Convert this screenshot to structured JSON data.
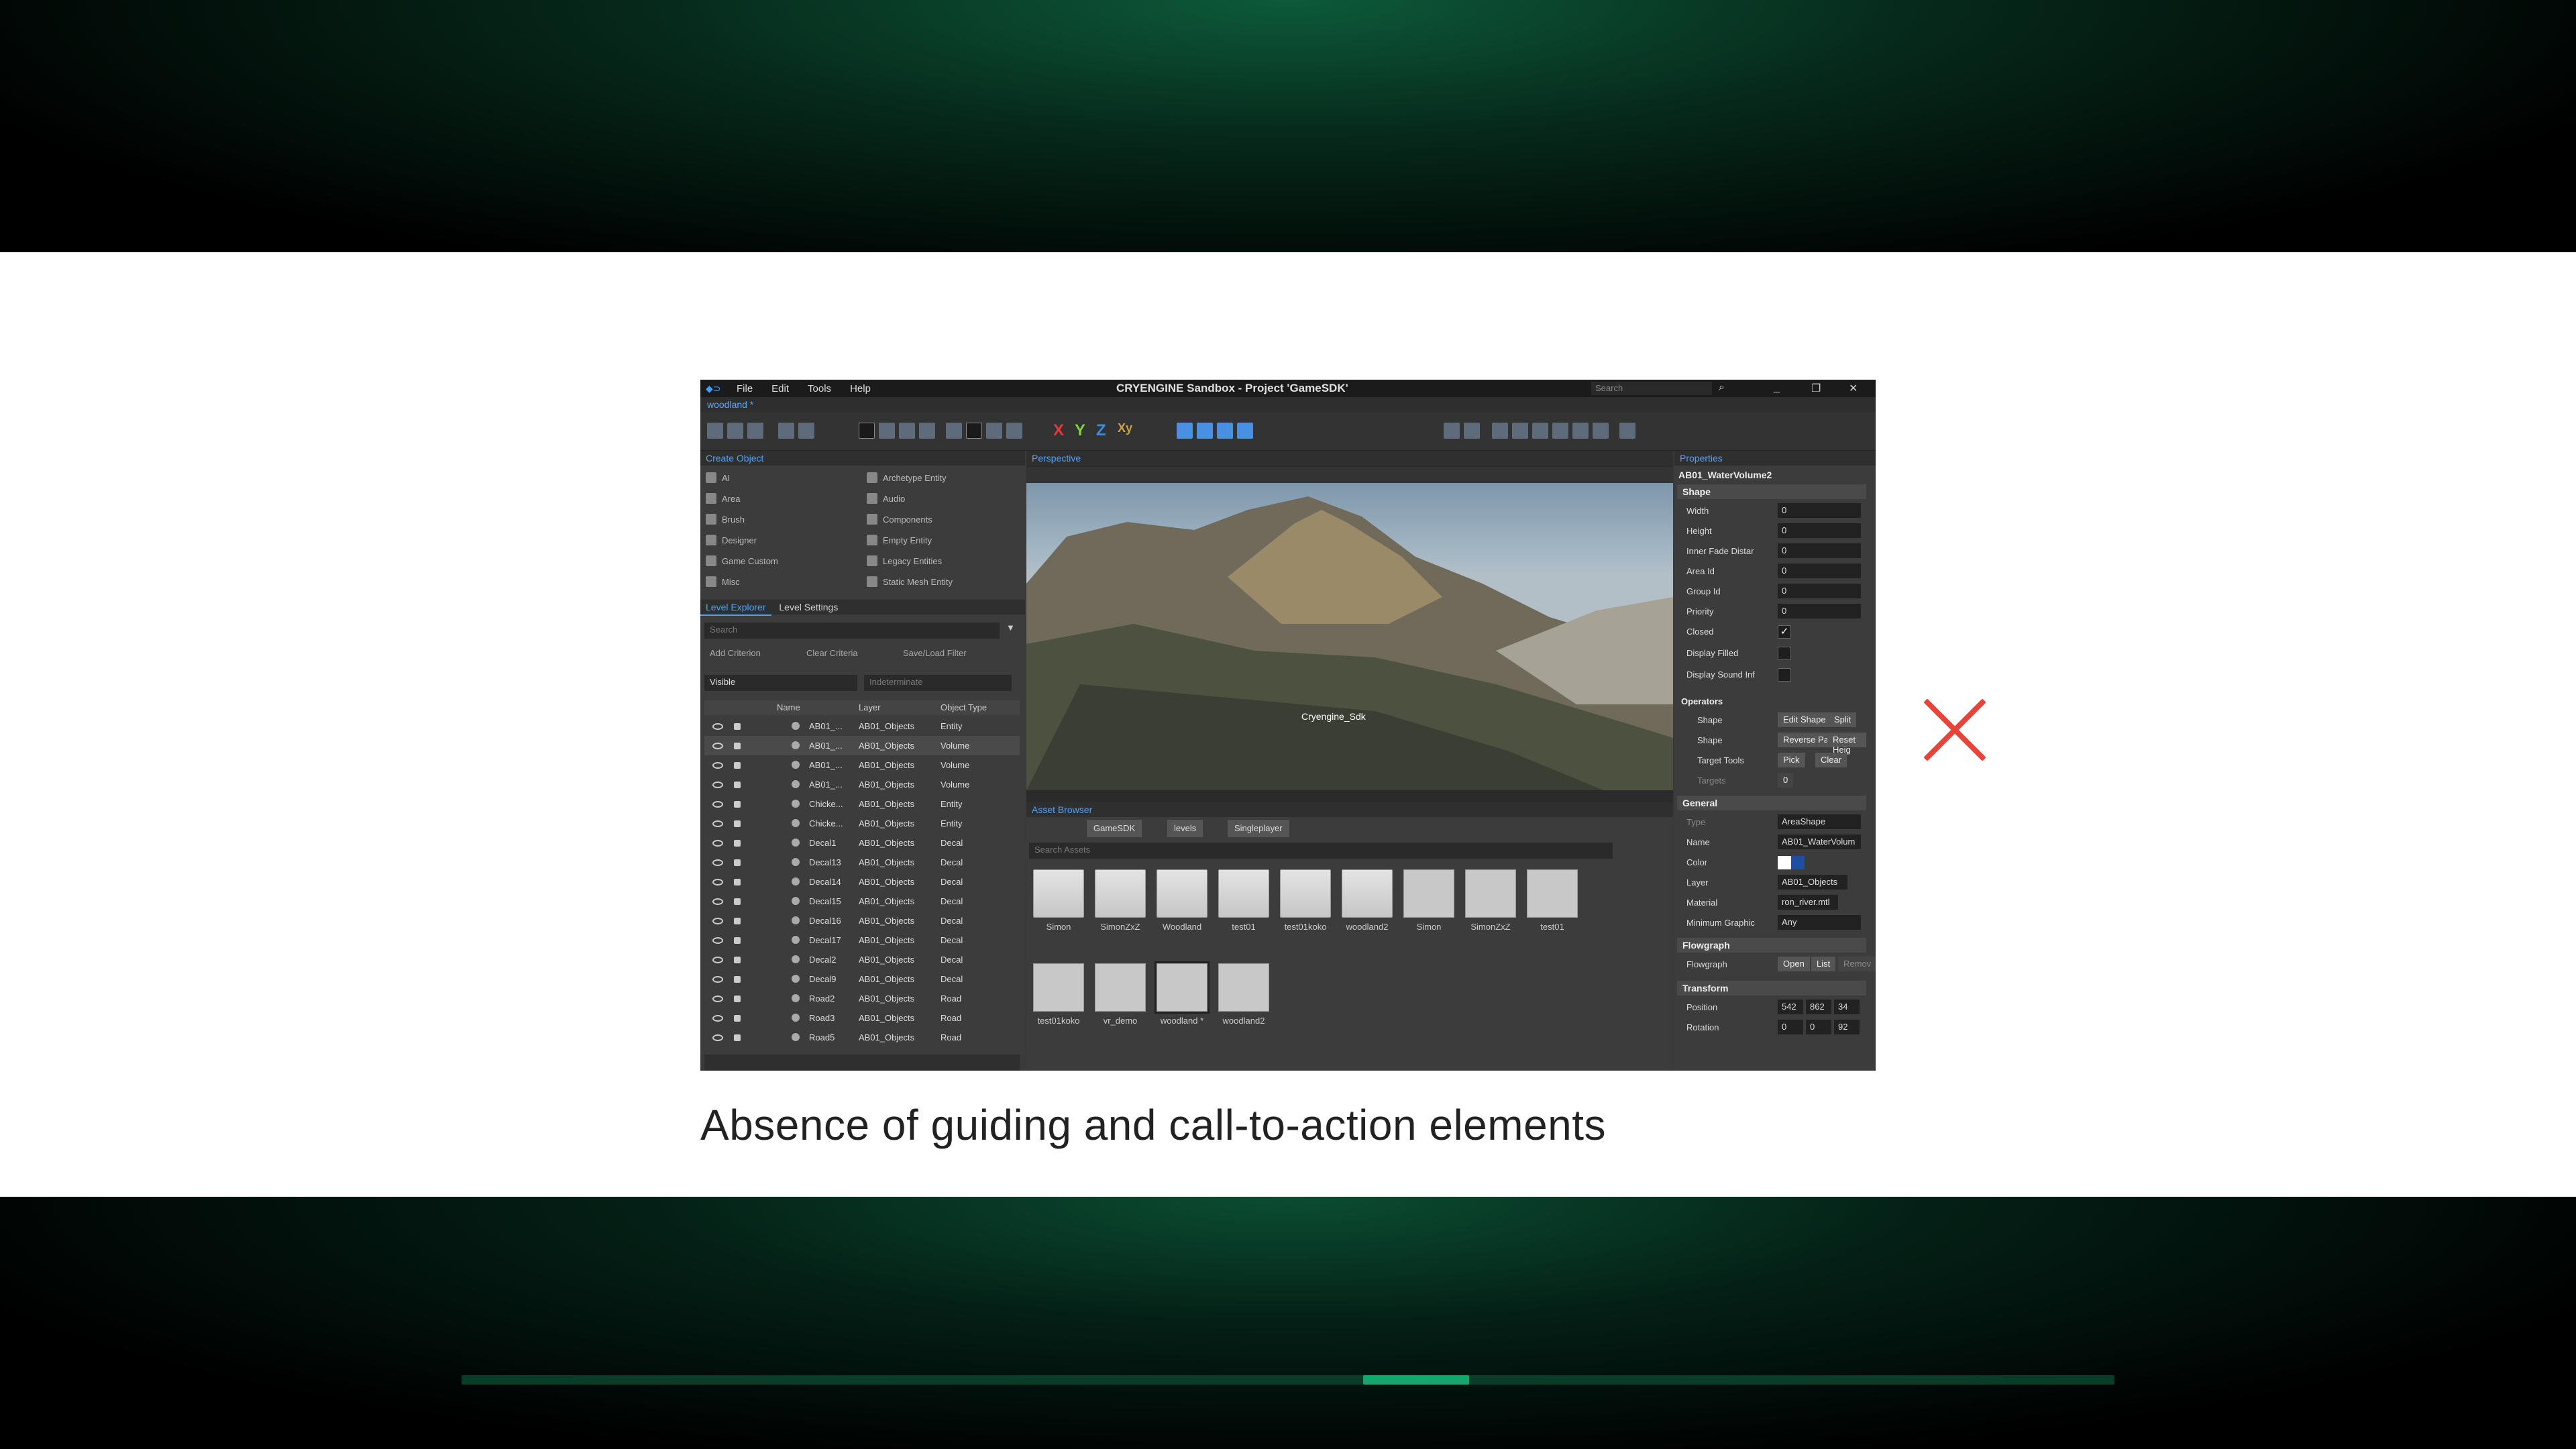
{
  "slide": {
    "caption": "Absence of guiding and call-to-action elements",
    "progress_fraction": 0.0641
  },
  "editor": {
    "menu": [
      "File",
      "Edit",
      "Tools",
      "Help"
    ],
    "window_title": "CRYENGINE Sandbox - Project 'GameSDK'",
    "search_placeholder": "Search",
    "level_name": "woodland *",
    "create_object": {
      "title": "Create Object",
      "left_items": [
        "AI",
        "Area",
        "Brush",
        "Designer",
        "Game Custom",
        "Misc"
      ],
      "right_items": [
        "Archetype Entity",
        "Audio",
        "Components",
        "Empty Entity",
        "Legacy Entities",
        "Static Mesh Entity"
      ]
    },
    "level_explorer": {
      "tabs": [
        "Level Explorer",
        "Level Settings"
      ],
      "search_placeholder": "Search",
      "add_criterion": "Add Criterion",
      "clear_criteria": "Clear Criteria",
      "save_load_filter": "Save/Load Filter",
      "visible": "Visible",
      "indeterminate": "Indeterminate",
      "columns": [
        "Name",
        "Layer",
        "Object Type"
      ],
      "rows": [
        {
          "name": "AB01_...",
          "layer": "AB01_Objects",
          "type": "Entity"
        },
        {
          "name": "AB01_...",
          "layer": "AB01_Objects",
          "type": "Volume"
        },
        {
          "name": "AB01_...",
          "layer": "AB01_Objects",
          "type": "Volume"
        },
        {
          "name": "AB01_...",
          "layer": "AB01_Objects",
          "type": "Volume"
        },
        {
          "name": "Chicke...",
          "layer": "AB01_Objects",
          "type": "Entity"
        },
        {
          "name": "Chicke...",
          "layer": "AB01_Objects",
          "type": "Entity"
        },
        {
          "name": "Decal1",
          "layer": "AB01_Objects",
          "type": "Decal"
        },
        {
          "name": "Decal13",
          "layer": "AB01_Objects",
          "type": "Decal"
        },
        {
          "name": "Decal14",
          "layer": "AB01_Objects",
          "type": "Decal"
        },
        {
          "name": "Decal15",
          "layer": "AB01_Objects",
          "type": "Decal"
        },
        {
          "name": "Decal16",
          "layer": "AB01_Objects",
          "type": "Decal"
        },
        {
          "name": "Decal17",
          "layer": "AB01_Objects",
          "type": "Decal"
        },
        {
          "name": "Decal2",
          "layer": "AB01_Objects",
          "type": "Decal"
        },
        {
          "name": "Decal9",
          "layer": "AB01_Objects",
          "type": "Decal"
        },
        {
          "name": "Road2",
          "layer": "AB01_Objects",
          "type": "Road"
        },
        {
          "name": "Road3",
          "layer": "AB01_Objects",
          "type": "Road"
        },
        {
          "name": "Road5",
          "layer": "AB01_Objects",
          "type": "Road"
        }
      ]
    },
    "viewport": {
      "title": "Perspective",
      "overlay_label": "Cryengine_Sdk"
    },
    "asset_browser": {
      "title": "Asset Browser",
      "crumbs": [
        "GameSDK",
        "levels",
        "Singleplayer"
      ],
      "search_placeholder": "Search Assets",
      "row1": [
        {
          "label": "Simon",
          "kind": "folder"
        },
        {
          "label": "SimonZxZ",
          "kind": "folder"
        },
        {
          "label": "Woodland",
          "kind": "folder"
        },
        {
          "label": "test01",
          "kind": "folder"
        },
        {
          "label": "test01koko",
          "kind": "folder"
        },
        {
          "label": "woodland2",
          "kind": "folder"
        },
        {
          "label": "Simon",
          "kind": "file"
        },
        {
          "label": "SimonZxZ",
          "kind": "file"
        },
        {
          "label": "test01",
          "kind": "file"
        }
      ],
      "row2": [
        {
          "label": "test01koko",
          "kind": "file"
        },
        {
          "label": "vr_demo",
          "kind": "file"
        },
        {
          "label": "woodland *",
          "kind": "file"
        },
        {
          "label": "woodland2",
          "kind": "file"
        }
      ]
    },
    "properties": {
      "title": "Properties",
      "object_name": "AB01_WaterVolume2",
      "shape_section": "Shape",
      "shape_rows": [
        {
          "key": "Width",
          "value": "0"
        },
        {
          "key": "Height",
          "value": "0"
        },
        {
          "key": "Inner Fade Distar",
          "value": "0"
        },
        {
          "key": "Area Id",
          "value": "0"
        },
        {
          "key": "Group Id",
          "value": "0"
        },
        {
          "key": "Priority",
          "value": "0"
        }
      ],
      "checks": [
        {
          "key": "Closed",
          "value": "✓"
        },
        {
          "key": "Display Filled",
          "value": ""
        },
        {
          "key": "Display Sound Inf",
          "value": ""
        }
      ],
      "operators": "Operators",
      "op_shape1": "Shape",
      "op_edit": "Edit Shape",
      "op_split": "Split",
      "op_shape2": "Shape",
      "op_reverse": "Reverse Path",
      "op_reset": "Reset Heig",
      "target_tools": "Target Tools",
      "pick": "Pick",
      "clear": "Clear",
      "targets": "Targets",
      "targets_val": "0",
      "general_section": "General",
      "type_key": "Type",
      "type_val": "AreaShape",
      "name_key": "Name",
      "name_val": "AB01_WaterVolum",
      "color_key": "Color",
      "layer_key": "Layer",
      "layer_val": "AB01_Objects",
      "material_key": "Material",
      "material_val": "ron_river.mtl",
      "mingraph_key": "Minimum Graphic",
      "mingraph_val": "Any",
      "flowgraph_section": "Flowgraph",
      "flowgraph_key": "Flowgraph",
      "open": "Open",
      "list": "List",
      "remove": "Remov",
      "transform_section": "Transform",
      "position_key": "Position",
      "position_vals": [
        "542",
        "862",
        "34"
      ],
      "rotation_key": "Rotation",
      "rotation_vals": [
        "0",
        "0",
        "92"
      ]
    }
  }
}
